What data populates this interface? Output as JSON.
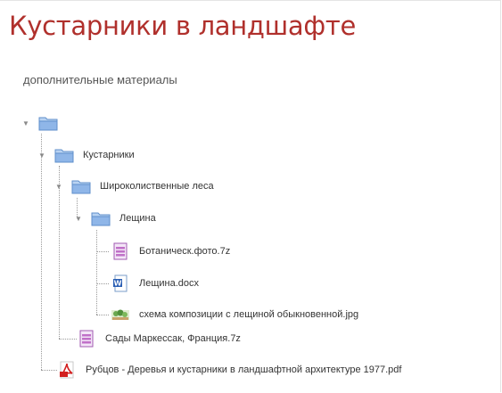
{
  "page": {
    "title": "Кустарники в ландшафте",
    "subtitle": "дополнительные материалы"
  },
  "tree": {
    "root": {
      "name": ""
    },
    "shrubs": {
      "name": "Кустарники"
    },
    "broadleaf": {
      "name": "Широколиственные леса"
    },
    "hazel": {
      "name": "Лещина"
    },
    "files": {
      "botanic": "Ботаническ.фото.7z",
      "hazel_docx": "Лещина.docx",
      "scheme_jpg": "схема композиции с лещиной обыкновенной.jpg",
      "gardens": "Сады Маркессак, Франция.7z",
      "rubtsov_pdf": "Рубцов - Деревья и кустарники в ландшафтной архитектуре 1977.pdf"
    }
  },
  "icons": {
    "toggle": "triangle-down-icon",
    "folder": "folder-icon",
    "archive": "archive-file-icon",
    "word": "word-document-icon",
    "image": "image-file-icon",
    "pdf": "pdf-file-icon"
  },
  "colors": {
    "title": "#b0302c",
    "folder": "#8fb6e8",
    "archive": "#c070c8",
    "pdf": "#d21f1f"
  }
}
